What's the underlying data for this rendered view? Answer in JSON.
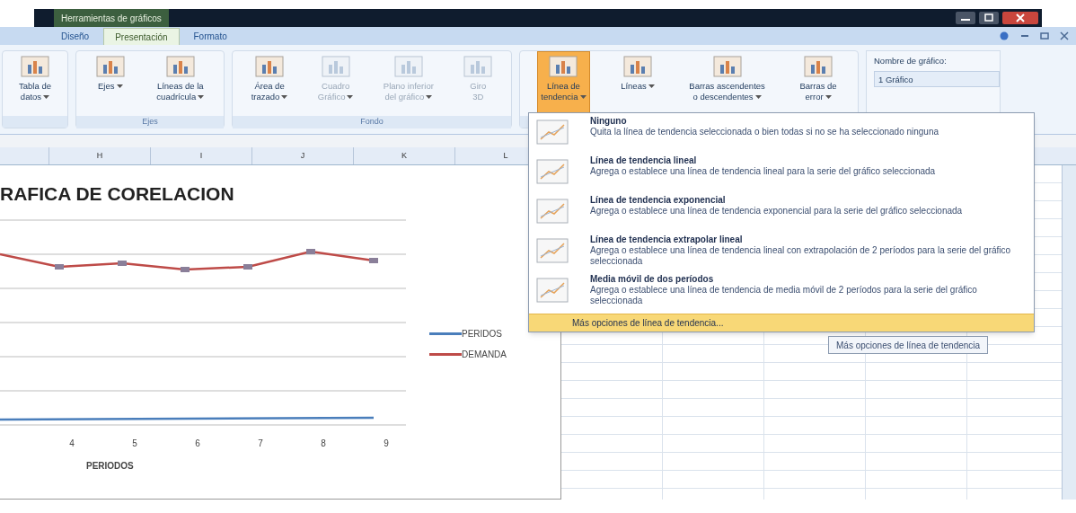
{
  "window": {
    "title": "Herramientas de gráficos"
  },
  "tabs": [
    {
      "label": "Diseño",
      "selected": false
    },
    {
      "label": "Presentación",
      "selected": true
    },
    {
      "label": "Formato",
      "selected": false
    }
  ],
  "ribbon": {
    "groups": [
      {
        "buttons": [
          {
            "label": "Tabla de\ndatos",
            "dropdown": true,
            "disabled": false,
            "active": false
          }
        ]
      },
      {
        "label": "Ejes",
        "buttons": [
          {
            "label": "Ejes",
            "dropdown": true,
            "disabled": false,
            "active": false
          },
          {
            "label": "Líneas de la\ncuadrícula",
            "dropdown": true,
            "disabled": false,
            "active": false
          }
        ]
      },
      {
        "label": "Fondo",
        "buttons": [
          {
            "label": "Área de\ntrazado",
            "dropdown": true,
            "disabled": false,
            "active": false
          },
          {
            "label": "Cuadro\nGráfico",
            "dropdown": true,
            "disabled": true,
            "active": false
          },
          {
            "label": "Plano inferior\ndel gráfico",
            "dropdown": true,
            "disabled": true,
            "active": false
          },
          {
            "label": "Giro\n3D",
            "dropdown": false,
            "disabled": true,
            "active": false
          }
        ]
      },
      {
        "buttons": [
          {
            "label": "Línea de\ntendencia",
            "dropdown": true,
            "disabled": false,
            "active": true
          },
          {
            "label": "Líneas",
            "dropdown": true,
            "disabled": false,
            "active": false
          },
          {
            "label": "Barras ascendentes\no descendentes",
            "dropdown": true,
            "disabled": false,
            "active": false
          },
          {
            "label": "Barras de\nerror",
            "dropdown": true,
            "disabled": false,
            "active": false
          }
        ]
      }
    ],
    "chart_name": {
      "label": "Nombre de gráfico:",
      "value": "1 Gráfico"
    }
  },
  "columns": [
    "",
    "H",
    "I",
    "J",
    "K",
    "L"
  ],
  "chart": {
    "title": "RAFICA DE CORELACION",
    "x_labels": [
      "4",
      "5",
      "6",
      "7",
      "8",
      "9"
    ],
    "x_title": "PERIODOS",
    "legend": [
      {
        "label": "PERIDOS",
        "color": "#4a7ebb"
      },
      {
        "label": "DEMANDA",
        "color": "#be4b48"
      }
    ]
  },
  "menu": {
    "items": [
      {
        "title": "Ninguno",
        "description": "Quita la línea de tendencia seleccionada o bien todas si no se ha seleccionado ninguna"
      },
      {
        "title": "Línea de tendencia lineal",
        "description": "Agrega o establece una línea de tendencia lineal para la serie del gráfico seleccionada"
      },
      {
        "title": "Línea de tendencia exponencial",
        "description": "Agrega o establece una línea de tendencia exponencial para la serie del gráfico seleccionada"
      },
      {
        "title": "Línea de tendencia extrapolar lineal",
        "description": "Agrega o establece una línea de tendencia lineal con extrapolación de 2 períodos para la serie del gráfico seleccionada"
      },
      {
        "title": "Media móvil de dos períodos",
        "description": "Agrega o establece una línea de tendencia de media móvil de 2 períodos para la serie del gráfico seleccionada"
      }
    ],
    "footer": {
      "label": "Más opciones de línea de tendencia...",
      "selected": true
    }
  },
  "tooltip": "Más opciones de línea de tendencia"
}
